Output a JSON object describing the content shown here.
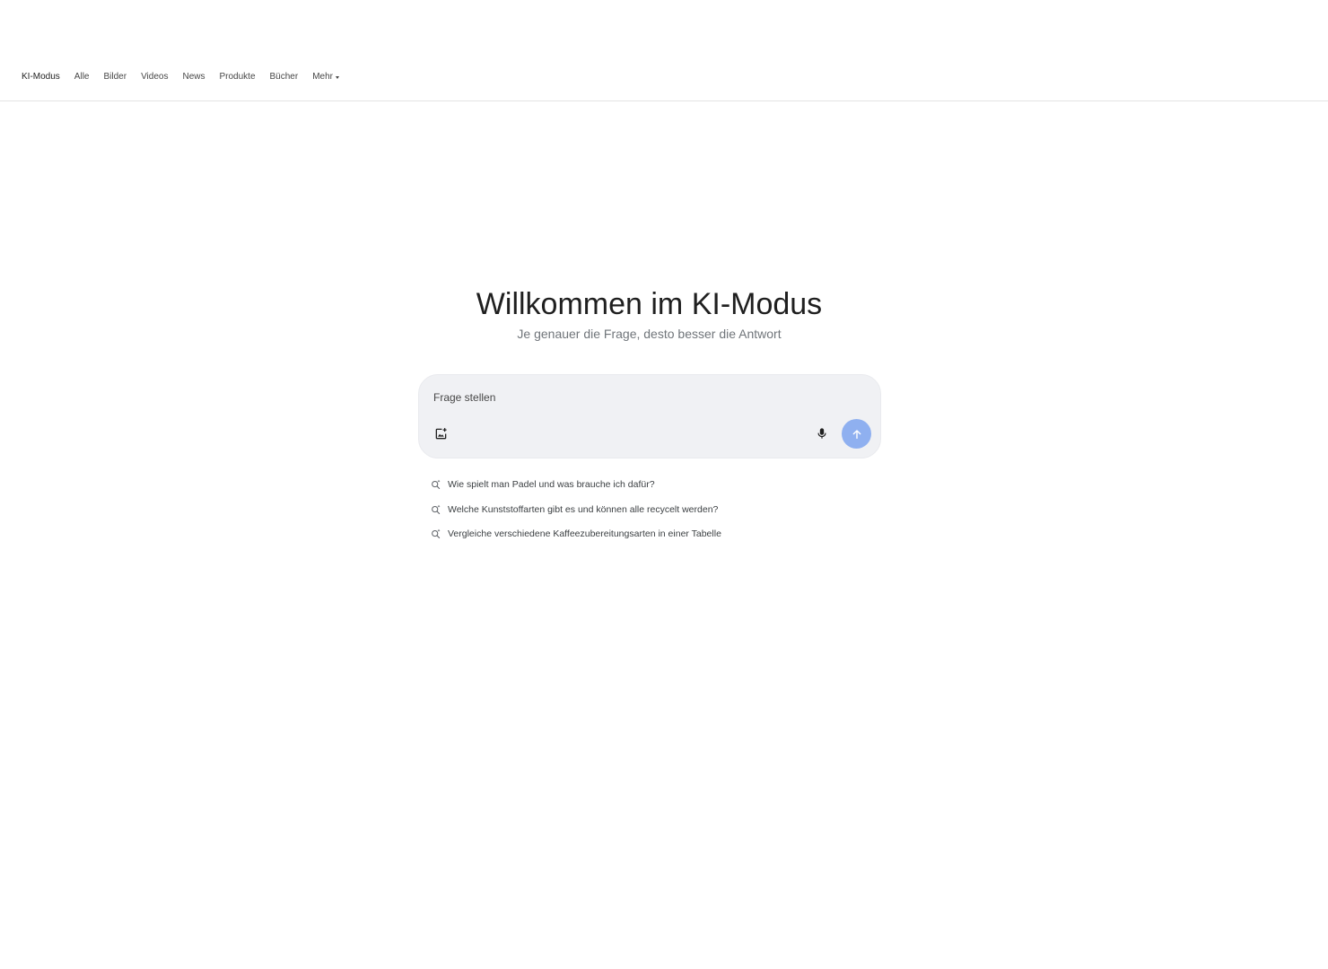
{
  "nav": {
    "tabs": [
      {
        "label": "KI-Modus",
        "active": true
      },
      {
        "label": "Alle"
      },
      {
        "label": "Bilder"
      },
      {
        "label": "Videos"
      },
      {
        "label": "News"
      },
      {
        "label": "Produkte"
      },
      {
        "label": "Bücher"
      },
      {
        "label": "Mehr",
        "has_dropdown": true
      }
    ]
  },
  "hero": {
    "title": "Willkommen im KI-Modus",
    "subtitle": "Je genauer die Frage, desto besser die Antwort"
  },
  "search": {
    "placeholder": "Frage stellen",
    "value": ""
  },
  "suggestions": [
    {
      "text": "Wie spielt man Padel und was brauche ich dafür?",
      "icon": "search-sparkle-icon"
    },
    {
      "text": "Welche Kunststoffarten gibt es und können alle recycelt werden?",
      "icon": "search-sparkle-icon"
    },
    {
      "text": "Vergleiche verschiedene Kaffeezubereitungsarten in einer Tabelle",
      "icon": "search-sparkle-icon"
    }
  ],
  "colors": {
    "send_button": "#8fb0f0",
    "searchbox_bg": "#f0f1f4",
    "subtitle": "#70757a"
  }
}
